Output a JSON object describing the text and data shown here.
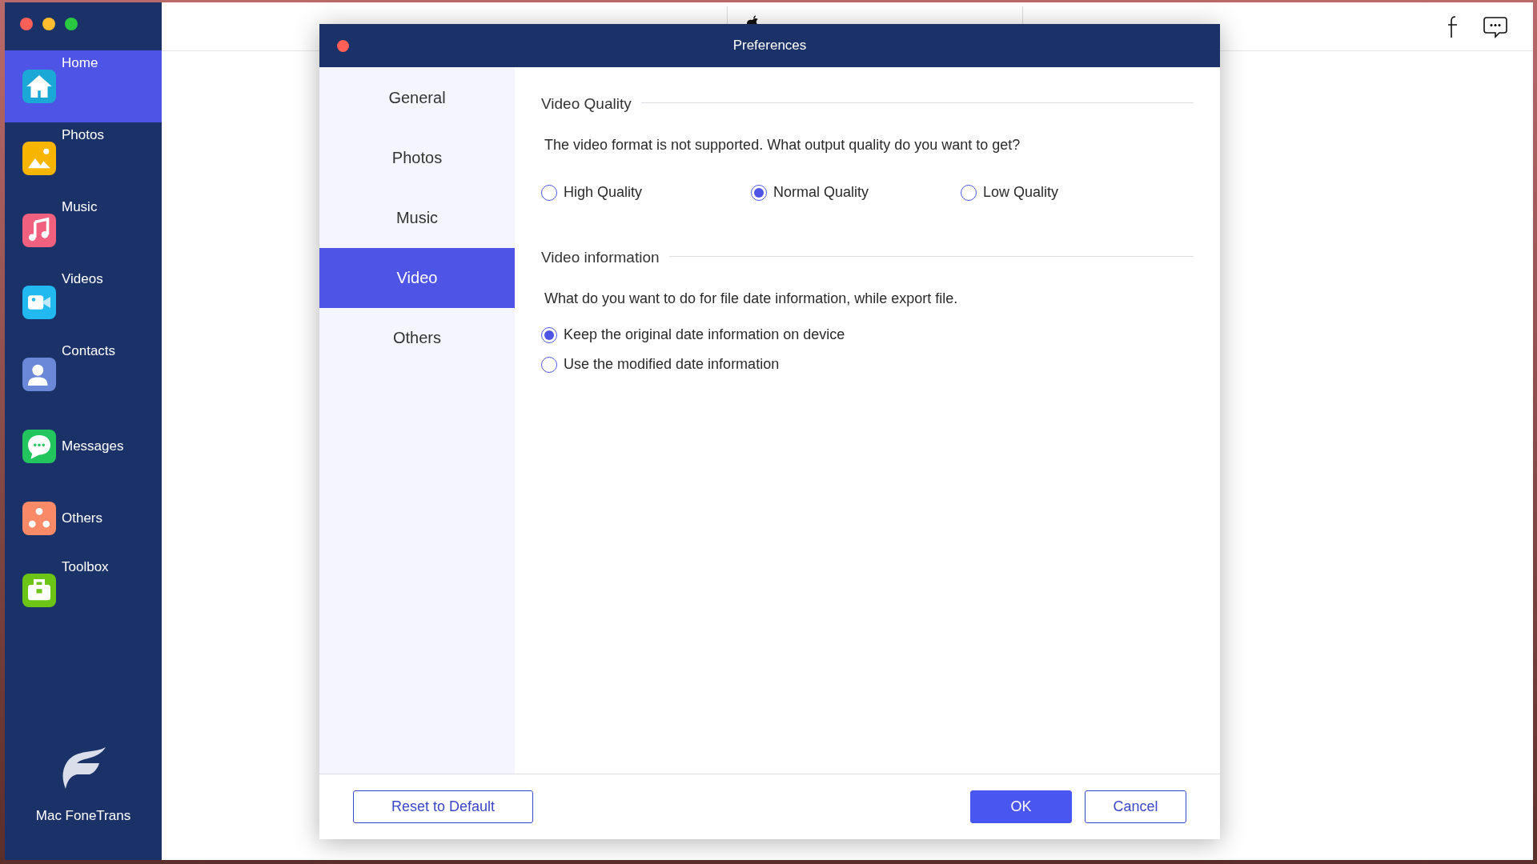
{
  "sidebar": {
    "items": [
      {
        "label": "Home",
        "selected": true,
        "kind": "top"
      },
      {
        "label": "Photos",
        "selected": false,
        "kind": "top"
      },
      {
        "label": "Music",
        "selected": false,
        "kind": "top"
      },
      {
        "label": "Videos",
        "selected": false,
        "kind": "top"
      },
      {
        "label": "Contacts",
        "selected": false,
        "kind": "top"
      },
      {
        "label": "Messages",
        "selected": false,
        "kind": "middle"
      },
      {
        "label": "Others",
        "selected": false,
        "kind": "middle"
      },
      {
        "label": "Toolbox",
        "selected": false,
        "kind": "top"
      }
    ],
    "app_name": "Mac FoneTrans"
  },
  "dialog": {
    "title": "Preferences",
    "nav": [
      {
        "label": "General",
        "selected": false
      },
      {
        "label": "Photos",
        "selected": false
      },
      {
        "label": "Music",
        "selected": false
      },
      {
        "label": "Video",
        "selected": true
      },
      {
        "label": "Others",
        "selected": false
      }
    ],
    "sections": [
      {
        "title": "Video Quality",
        "prompt": "The video format is not supported. What output quality do you want to get?",
        "kind": "row",
        "options": [
          {
            "label": "High Quality",
            "selected": false
          },
          {
            "label": "Normal Quality",
            "selected": true
          },
          {
            "label": "Low Quality",
            "selected": false
          }
        ]
      },
      {
        "title": "Video information",
        "prompt": "What do you want to do for file date information, while export file.",
        "kind": "column",
        "options": [
          {
            "label": "Keep the original date information on device",
            "selected": true
          },
          {
            "label": "Use the modified date information",
            "selected": false
          }
        ]
      }
    ],
    "buttons": [
      {
        "label": "Reset to Default",
        "kind": "outline"
      },
      {
        "label": "OK",
        "kind": "primary"
      },
      {
        "label": "Cancel",
        "kind": "outline"
      }
    ]
  }
}
